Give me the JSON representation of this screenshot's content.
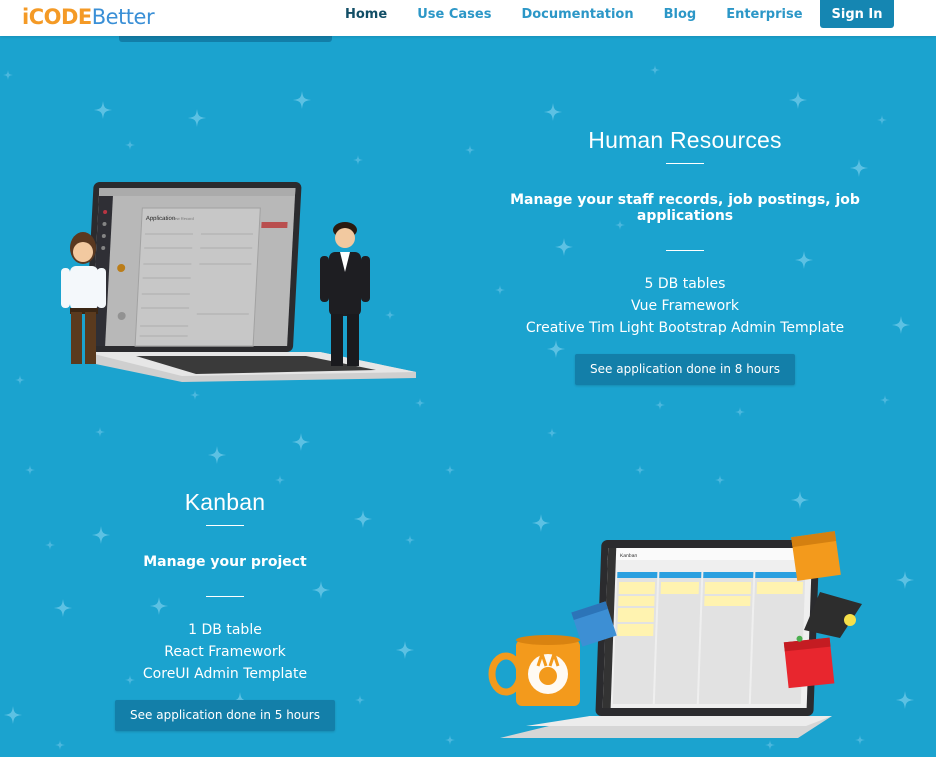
{
  "nav": {
    "logo_part1": "iCODE",
    "logo_part2": "Better",
    "links": [
      "Home",
      "Use Cases",
      "Documentation",
      "Blog",
      "Enterprise"
    ],
    "active": "Home",
    "signin": "Sign In"
  },
  "hr": {
    "title": "Human Resources",
    "subtitle": "Manage your staff records, job postings, job applications",
    "details": [
      "5 DB tables",
      "Vue Framework",
      "Creative Tim Light Bootstrap Admin Template"
    ],
    "cta": "See application done in 8 hours",
    "screen_form_title": "Application",
    "screen_form_subtitle": "New Record"
  },
  "kanban": {
    "title": "Kanban",
    "subtitle": "Manage your project",
    "details": [
      "1 DB table",
      "React Framework",
      "CoreUI Admin Template"
    ],
    "cta": "See application done in 5 hours",
    "screen_heading": "Kanban"
  },
  "colors": {
    "background": "#1ba3cf",
    "button": "#137fa9",
    "nav_active": "#124e66",
    "nav_link": "#2c97c7",
    "logo_orange": "#f49a26",
    "logo_blue": "#3a8fd6"
  }
}
